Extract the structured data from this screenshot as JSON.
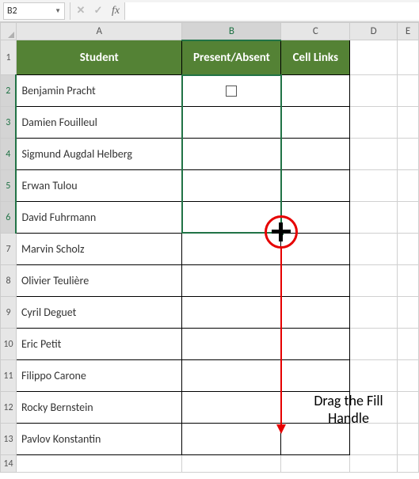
{
  "formula_bar": {
    "cell_ref": "B2",
    "formula": ""
  },
  "columns": [
    "A",
    "B",
    "C",
    "D",
    "E"
  ],
  "headers": {
    "student": "Student",
    "present": "Present/Absent",
    "links": "Cell Links"
  },
  "students": [
    "Benjamin Pracht",
    "Damien Fouilleul",
    "Sigmund Augdal Helberg",
    "Erwan Tulou",
    "David Fuhrmann",
    "Marvin Scholz",
    "Olivier Teulière",
    "Cyril Deguet",
    "Eric Petit",
    "Filippo Carone",
    "Rocky Bernstein",
    "Pavlov Konstantin"
  ],
  "annotation": {
    "line1": "Drag the Fill",
    "line2": "Handle"
  },
  "active": {
    "col": "B",
    "rows": "2:6"
  }
}
